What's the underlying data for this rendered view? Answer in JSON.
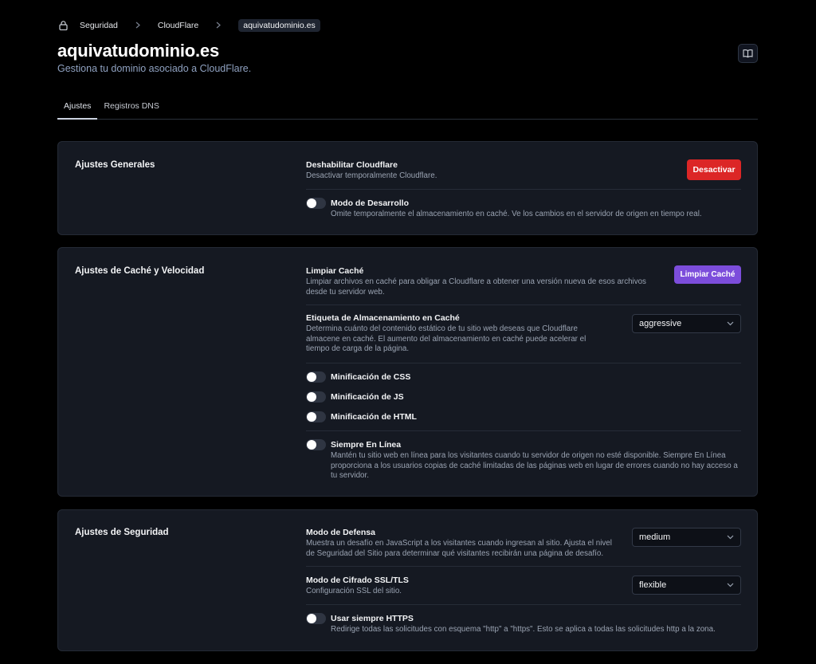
{
  "breadcrumb": {
    "items": [
      "Seguridad",
      "CloudFlare"
    ],
    "current": "aquivatudominio.es"
  },
  "header": {
    "title": "aquivatudominio.es",
    "subtitle": "Gestiona tu dominio asociado a CloudFlare."
  },
  "tabs": [
    {
      "label": "Ajustes",
      "active": true
    },
    {
      "label": "Registros DNS",
      "active": false
    }
  ],
  "general": {
    "title": "Ajustes Generales",
    "disable": {
      "label": "Deshabilitar Cloudflare",
      "desc": "Desactivar temporalmente Cloudflare.",
      "button": "Desactivar"
    },
    "devmode": {
      "label": "Modo de Desarrollo",
      "desc": "Omite temporalmente el almacenamiento en caché. Ve los cambios en el servidor de origen en tiempo real.",
      "enabled": false
    }
  },
  "cache": {
    "title": "Ajustes de Caché y Velocidad",
    "purge": {
      "label": "Limpiar Caché",
      "desc": "Limpiar archivos en caché para obligar a Cloudflare a obtener una versión nueva de esos archivos desde tu servidor web.",
      "button": "Limpiar Caché"
    },
    "cache_level": {
      "label": "Etiqueta de Almacenamiento en Caché",
      "desc": "Determina cuánto del contenido estático de tu sitio web deseas que Cloudflare almacene en caché. El aumento del almacenamiento en caché puede acelerar el tiempo de carga de la página.",
      "value": "aggressive"
    },
    "minify_css": {
      "label": "Minificación de CSS",
      "enabled": false
    },
    "minify_js": {
      "label": "Minificación de JS",
      "enabled": false
    },
    "minify_html": {
      "label": "Minificación de HTML",
      "enabled": false
    },
    "always_online": {
      "label": "Siempre En Línea",
      "desc": "Mantén tu sitio web en línea para los visitantes cuando tu servidor de origen no esté disponible. Siempre En Línea proporciona a los usuarios copias de caché limitadas de las páginas web en lugar de errores cuando no hay acceso a tu servidor.",
      "enabled": false
    }
  },
  "security": {
    "title": "Ajustes de Seguridad",
    "defense": {
      "label": "Modo de Defensa",
      "desc": "Muestra un desafío en JavaScript a los visitantes cuando ingresan al sitio. Ajusta el nivel de Seguridad del Sitio para determinar qué visitantes recibirán una página de desafío.",
      "value": "medium"
    },
    "ssl": {
      "label": "Modo de Cifrado SSL/TLS",
      "desc": "Configuración SSL del sitio.",
      "value": "flexible"
    },
    "https": {
      "label": "Usar siempre HTTPS",
      "desc": "Redirige todas las solicitudes con esquema \"http\" a \"https\". Esto se aplica a todas las solicitudes http a la zona.",
      "enabled": false
    }
  },
  "colors": {
    "danger": "#dc2626",
    "accent": "#7c4ddb",
    "card_bg": "#151922"
  },
  "icons": {
    "breadcrumb_root": "lock-icon",
    "breadcrumb_sep": "chevron-right-icon",
    "docs": "book-open-icon",
    "select": "chevron-down-icon"
  }
}
